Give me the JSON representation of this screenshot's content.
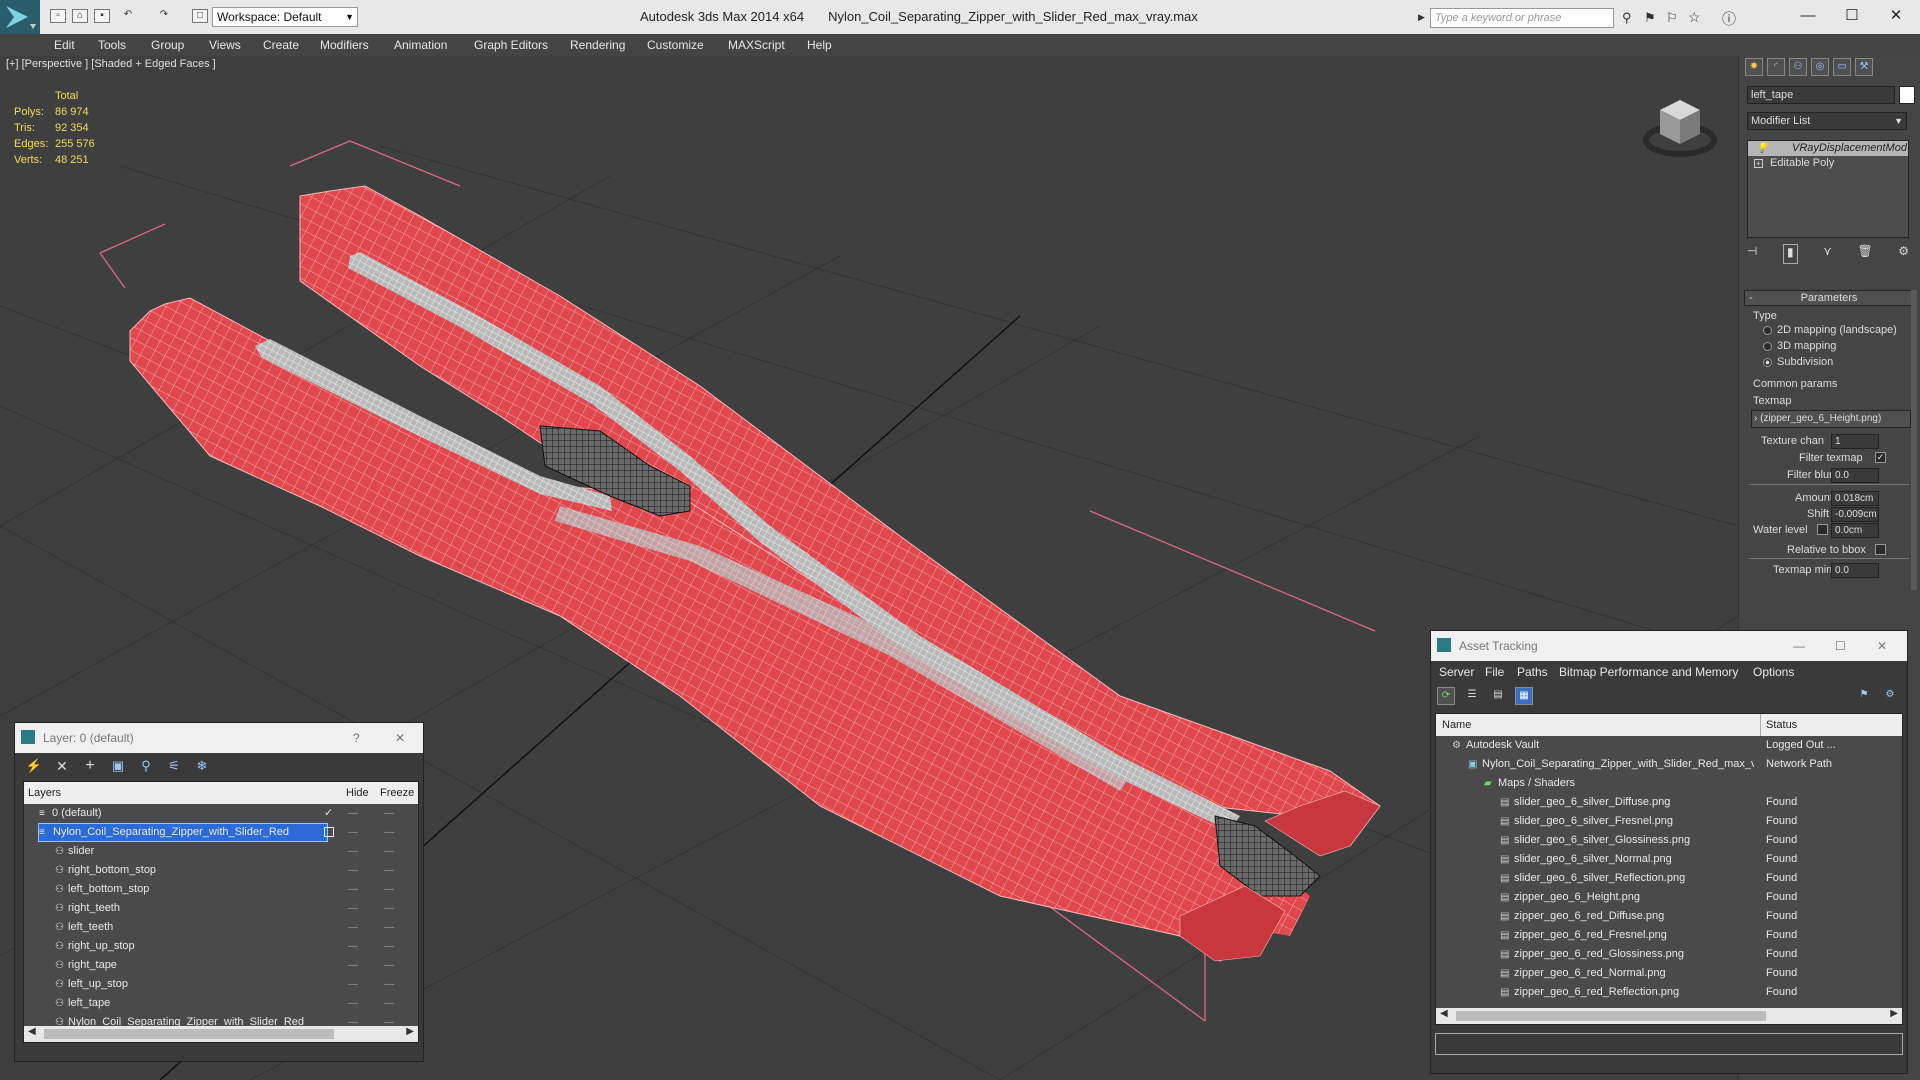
{
  "titlebar": {
    "app": "Autodesk 3ds Max  2014 x64",
    "file": "Nylon_Coil_Separating_Zipper_with_Slider_Red_max_vray.max",
    "workspace": "Workspace: Default",
    "search_placeholder": "Type a keyword or phrase"
  },
  "menus": [
    "Edit",
    "Tools",
    "Group",
    "Views",
    "Create",
    "Modifiers",
    "Animation",
    "Graph Editors",
    "Rendering",
    "Customize",
    "MAXScript",
    "Help"
  ],
  "viewport": {
    "label": "[+] [Perspective ] [Shaded + Edged Faces ]",
    "stats": {
      "header": "Total",
      "polys_label": "Polys:",
      "polys": "86 974",
      "tris_label": "Tris:",
      "tris": "92 354",
      "edges_label": "Edges:",
      "edges": "255 576",
      "verts_label": "Verts:",
      "verts": "48 251"
    }
  },
  "command_panel": {
    "object_name": "left_tape",
    "modifier_list": "Modifier List",
    "stack": [
      "VRayDisplacementMod",
      "Editable Poly"
    ],
    "rollout": "Parameters",
    "type_label": "Type",
    "type_options": [
      "2D mapping (landscape)",
      "3D mapping",
      "Subdivision"
    ],
    "type_selected": 2,
    "common_params": "Common params",
    "texmap_label": "Texmap",
    "texmap_value": "› (zipper_geo_6_Height.png)",
    "texture_chan_label": "Texture chan",
    "texture_chan": "1",
    "filter_texmap_label": "Filter texmap",
    "filter_blur_label": "Filter blur",
    "filter_blur": "0.0",
    "amount_label": "Amount",
    "amount": "0.018cm",
    "shift_label": "Shift",
    "shift": "-0.009cm",
    "water_level_label": "Water level",
    "water_level": "0.0cm",
    "relative_bbox_label": "Relative to bbox",
    "texmap_min_label": "Texmap min",
    "texmap_min": "0.0"
  },
  "layers": {
    "title": "Layer: 0 (default)",
    "help": "?",
    "close": "✕",
    "col_layers": "Layers",
    "col_hide": "Hide",
    "col_freeze": "Freeze",
    "rows": [
      {
        "name": "0 (default)",
        "level": 0
      },
      {
        "name": "Nylon_Coil_Separating_Zipper_with_Slider_Red",
        "level": 0,
        "selected": true
      },
      {
        "name": "slider",
        "level": 1
      },
      {
        "name": "right_bottom_stop",
        "level": 1
      },
      {
        "name": "left_bottom_stop",
        "level": 1
      },
      {
        "name": "right_teeth",
        "level": 1
      },
      {
        "name": "left_teeth",
        "level": 1
      },
      {
        "name": "right_up_stop",
        "level": 1
      },
      {
        "name": "right_tape",
        "level": 1
      },
      {
        "name": "left_up_stop",
        "level": 1
      },
      {
        "name": "left_tape",
        "level": 1
      },
      {
        "name": "Nylon_Coil_Separating_Zipper_with_Slider_Red",
        "level": 1
      }
    ],
    "dash": "—"
  },
  "asset": {
    "title": "Asset Tracking",
    "menus": [
      "Server",
      "File",
      "Paths",
      "Bitmap Performance and Memory",
      "Options"
    ],
    "col_name": "Name",
    "col_status": "Status",
    "rows": [
      {
        "name": "Autodesk Vault",
        "status": "Logged Out ...",
        "level": 0
      },
      {
        "name": "Nylon_Coil_Separating_Zipper_with_Slider_Red_max_vray.max",
        "status": "Network Path",
        "level": 1
      },
      {
        "name": "Maps / Shaders",
        "status": "",
        "level": 2
      },
      {
        "name": "slider_geo_6_silver_Diffuse.png",
        "status": "Found",
        "level": 3
      },
      {
        "name": "slider_geo_6_silver_Fresnel.png",
        "status": "Found",
        "level": 3
      },
      {
        "name": "slider_geo_6_silver_Glossiness.png",
        "status": "Found",
        "level": 3
      },
      {
        "name": "slider_geo_6_silver_Normal.png",
        "status": "Found",
        "level": 3
      },
      {
        "name": "slider_geo_6_silver_Reflection.png",
        "status": "Found",
        "level": 3
      },
      {
        "name": "zipper_geo_6_Height.png",
        "status": "Found",
        "level": 3
      },
      {
        "name": "zipper_geo_6_red_Diffuse.png",
        "status": "Found",
        "level": 3
      },
      {
        "name": "zipper_geo_6_red_Fresnel.png",
        "status": "Found",
        "level": 3
      },
      {
        "name": "zipper_geo_6_red_Glossiness.png",
        "status": "Found",
        "level": 3
      },
      {
        "name": "zipper_geo_6_red_Normal.png",
        "status": "Found",
        "level": 3
      },
      {
        "name": "zipper_geo_6_red_Reflection.png",
        "status": "Found",
        "level": 3
      }
    ]
  },
  "colors": {
    "zipper_red": "#e0484e",
    "selection": "#2b6bd8",
    "stats_yellow": "#f0dd5a"
  }
}
